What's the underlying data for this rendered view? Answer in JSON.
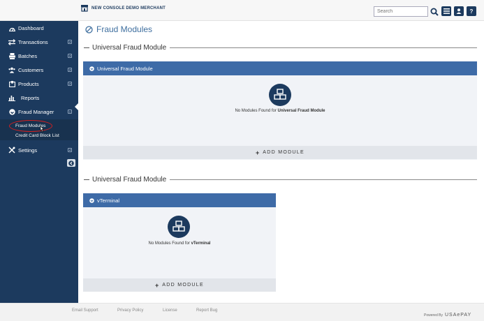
{
  "header": {
    "merchant_name": "NEW CONSOLE DEMO MERCHANT",
    "search_placeholder": "Search",
    "help_label": "?"
  },
  "sidebar": {
    "items": [
      {
        "label": "Dashboard",
        "icon": "dashboard-icon"
      },
      {
        "label": "Transactions",
        "icon": "transactions-icon"
      },
      {
        "label": "Batches",
        "icon": "batches-icon"
      },
      {
        "label": "Customers",
        "icon": "customers-icon"
      },
      {
        "label": "Products",
        "icon": "products-icon"
      },
      {
        "label": "Reports",
        "icon": "reports-icon"
      },
      {
        "label": "Fraud Manager",
        "icon": "fraud-manager-icon"
      },
      {
        "label": "Settings",
        "icon": "settings-icon"
      }
    ],
    "fraud_submenu": [
      "Fraud Modules",
      "Credit Card Block List"
    ]
  },
  "main": {
    "page_title": "Fraud Modules",
    "sections": [
      {
        "heading": "Universal Fraud Module",
        "panel_title": "Universal Fraud Module",
        "empty_prefix": "No Modules Found for ",
        "empty_name": "Universal Fraud Module",
        "add_label": "ADD MODULE"
      },
      {
        "heading": "Universal Fraud Module",
        "panel_title": "vTerminal",
        "empty_prefix": "No Modules Found for ",
        "empty_name": "vTerminal",
        "add_label": "ADD MODULE"
      }
    ]
  },
  "footer": {
    "links": [
      "Email Support",
      "Privacy Policy",
      "License",
      "Report Bug"
    ],
    "powered_by": "Powered By",
    "brand": "USAePAY"
  },
  "colors": {
    "sidebar_bg": "#1c3a5e",
    "panel_header": "#3e6ba7",
    "title_blue": "#3f6f9f",
    "highlight_red": "#d42020"
  }
}
